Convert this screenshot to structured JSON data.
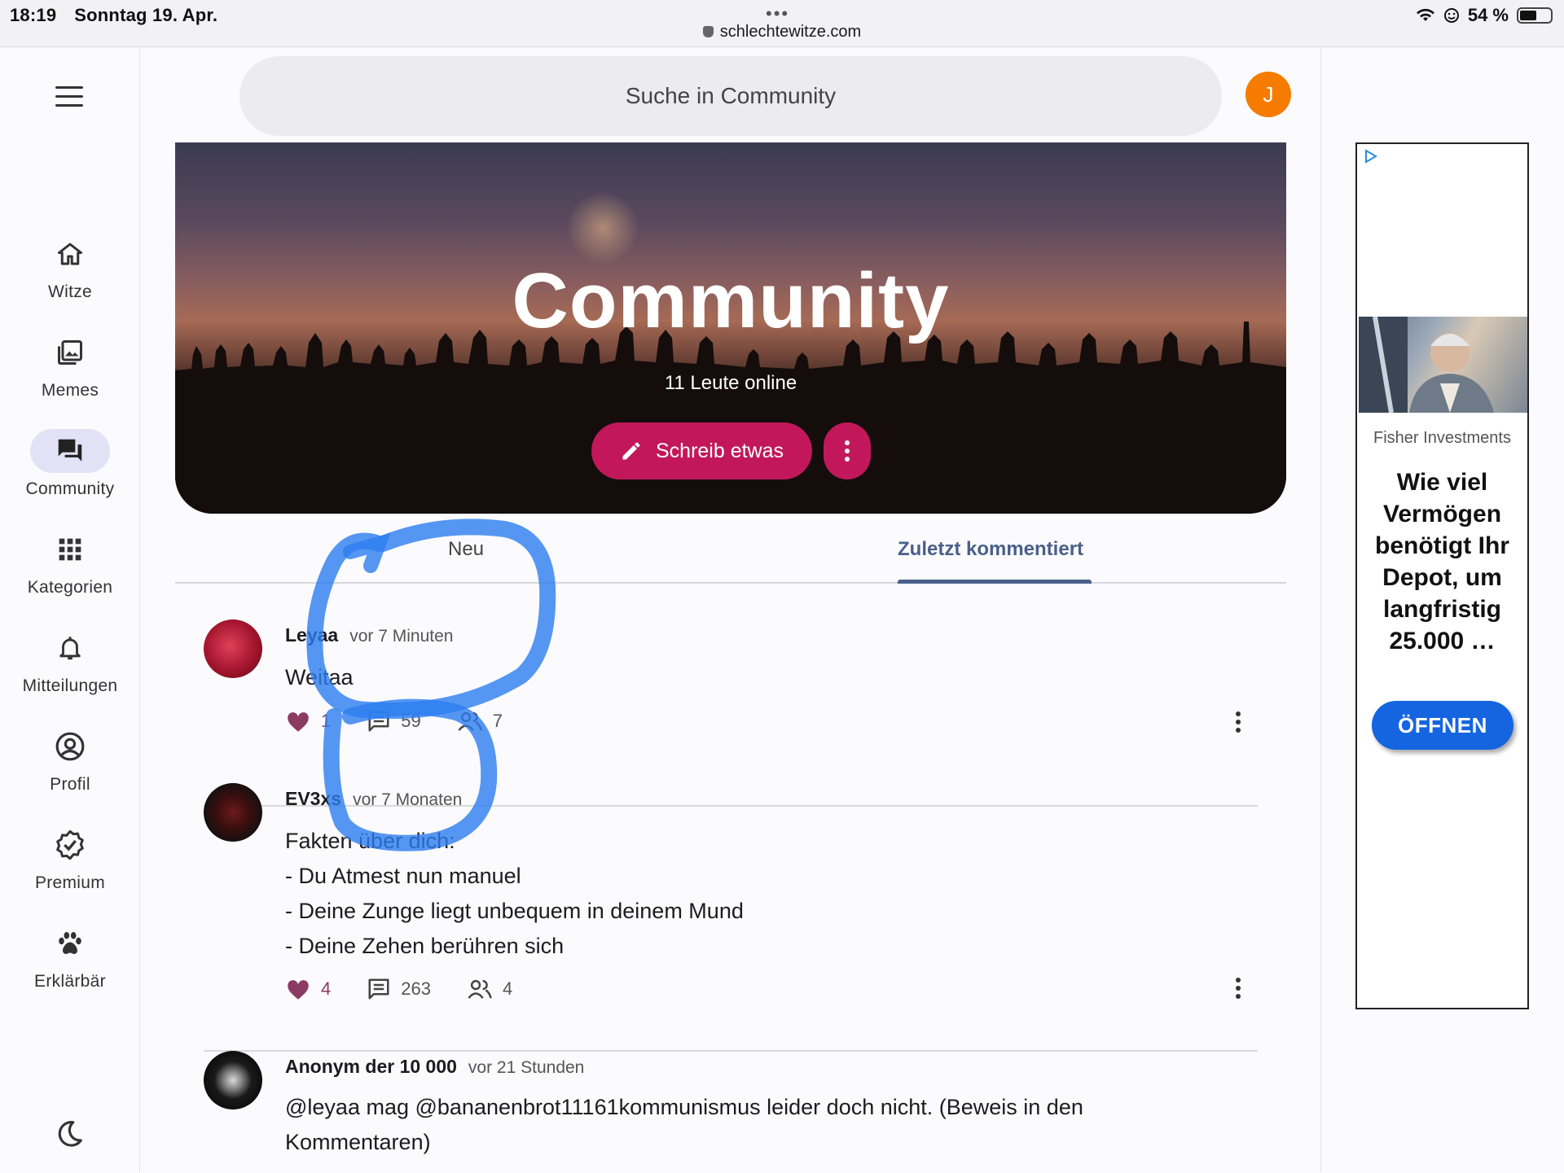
{
  "status_bar": {
    "time": "18:19",
    "date": "Sonntag 19. Apr.",
    "url": "schlechtewitze.com",
    "battery": "54 %"
  },
  "sidebar": {
    "items": [
      {
        "label": "Witze",
        "icon": "home-icon"
      },
      {
        "label": "Memes",
        "icon": "images-icon"
      },
      {
        "label": "Community",
        "icon": "forum-icon",
        "active": true
      },
      {
        "label": "Kategorien",
        "icon": "grid-icon"
      },
      {
        "label": "Mitteilungen",
        "icon": "bell-icon"
      },
      {
        "label": "Profil",
        "icon": "account-circle-icon"
      },
      {
        "label": "Premium",
        "icon": "verified-badge-icon"
      },
      {
        "label": "Erklärbär",
        "icon": "paw-icon"
      }
    ]
  },
  "header": {
    "search_placeholder": "Suche in Community",
    "avatar_initial": "J",
    "avatar_color": "#f57c00"
  },
  "hero": {
    "title": "Community",
    "online": "11 Leute online",
    "write_label": "Schreib etwas",
    "accent": "#c2185b"
  },
  "tabs": [
    {
      "label": "Neu"
    },
    {
      "label": "Zuletzt kommentiert",
      "active": true
    }
  ],
  "posts": [
    {
      "author": "Leyaa",
      "time": "vor 7 Minuten",
      "lines": [
        "Weitaa"
      ],
      "likes": "1",
      "comments": "59",
      "participants": "7"
    },
    {
      "author": "EV3xs",
      "time": "vor 7 Monaten",
      "lines": [
        "Fakten über dich:",
        "- Du Atmest nun manuel",
        "- Deine Zunge liegt unbequem in deinem Mund",
        "- Deine Zehen berühren sich"
      ],
      "likes": "4",
      "comments": "263",
      "participants": "4"
    },
    {
      "author": "Anonym der 10 000",
      "time": "vor 21 Stunden",
      "lines": [
        "@leyaa mag @bananenbrot11161kommunismus leider doch nicht. (Beweis in den",
        "Kommentaren)"
      ]
    }
  ],
  "ad": {
    "advertiser": "Fisher Investments",
    "headline": "Wie viel Vermögen benötigt Ihr Depot, um langfristig 25.000 …",
    "cta": "ÖFFNEN",
    "cta_color": "#1565e0"
  }
}
